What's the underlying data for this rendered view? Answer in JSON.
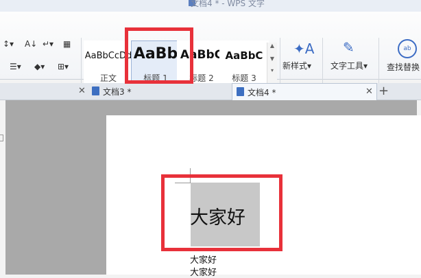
{
  "window": {
    "title": "文档4 * - WPS 文字"
  },
  "ribbon": {
    "styles": [
      {
        "preview": "AaBbCcDd",
        "name": "正文"
      },
      {
        "preview": "AaBb",
        "name": "标题 1"
      },
      {
        "preview": "AaBbC",
        "name": "标题 2"
      },
      {
        "preview": "AaBbC",
        "name": "标题 3"
      }
    ],
    "new_style_label": "新样式",
    "text_tools_label": "文字工具",
    "find_replace_label": "查找替换"
  },
  "tabs": [
    {
      "label": "文档3 *"
    },
    {
      "label": "文档4 *"
    }
  ],
  "document": {
    "heading_text": "大家好",
    "lines": [
      "大家好",
      "大家好"
    ]
  },
  "colors": {
    "highlight": "#e8313a",
    "selection": "#c8c8c8"
  }
}
